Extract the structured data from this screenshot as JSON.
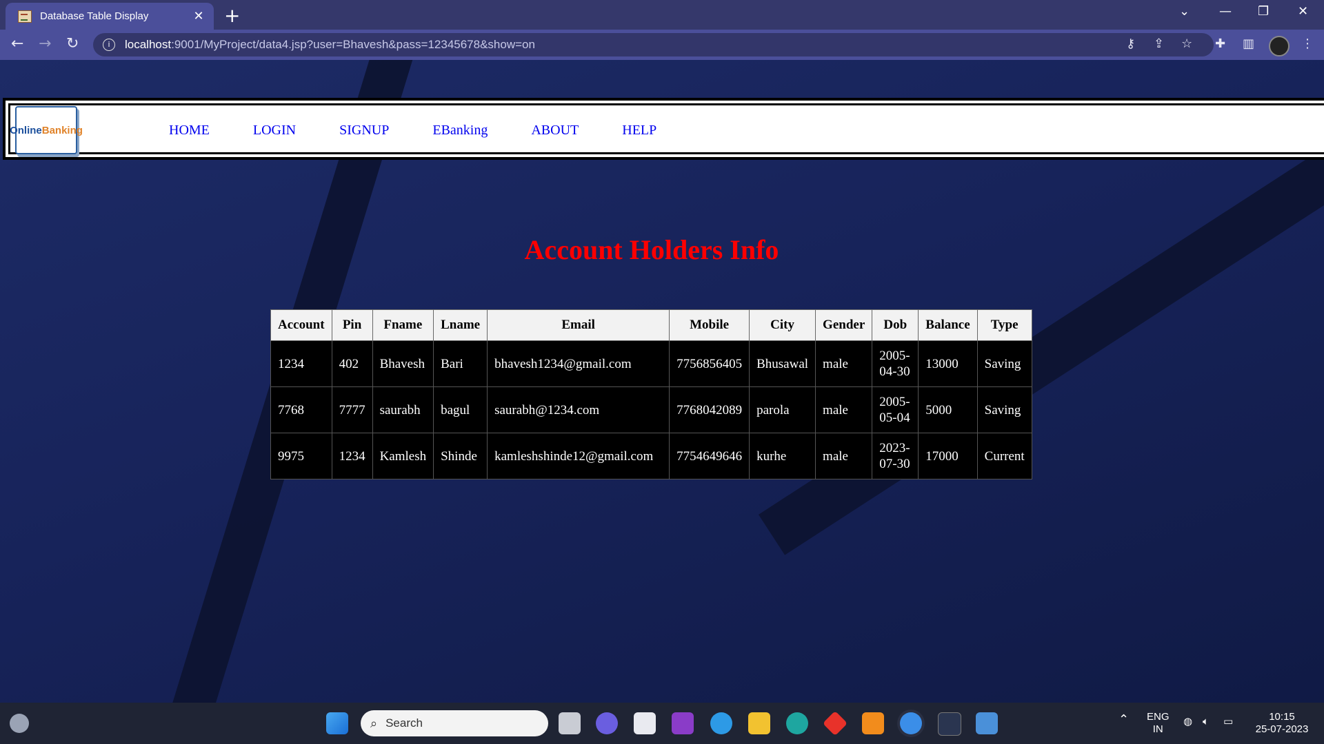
{
  "browser": {
    "tab_title": "Database Table Display",
    "tab_close": "✕",
    "new_tab": "+",
    "url_host": "localhost",
    "url_path": ":9001/MyProject/data4.jsp?user=Bhavesh&pass=12345678&show=on"
  },
  "nav": {
    "logo_part1": "Online",
    "logo_part2": "Banking",
    "items": [
      {
        "label": "HOME"
      },
      {
        "label": "LOGIN"
      },
      {
        "label": "SIGNUP"
      },
      {
        "label": "EBanking"
      },
      {
        "label": "ABOUT"
      },
      {
        "label": "HELP"
      }
    ]
  },
  "page": {
    "heading": "Account Holders Info"
  },
  "table": {
    "columns": [
      "Account",
      "Pin",
      "Fname",
      "Lname",
      "Email",
      "Mobile",
      "City",
      "Gender",
      "Dob",
      "Balance",
      "Type"
    ],
    "rows": [
      [
        "1234",
        "402",
        "Bhavesh",
        "Bari",
        "bhavesh1234@gmail.com",
        "7756856405",
        "Bhusawal",
        "male",
        "2005-04-30",
        "13000",
        "Saving"
      ],
      [
        "7768",
        "7777",
        "saurabh",
        "bagul",
        "saurabh@1234.com",
        "7768042089",
        "parola",
        "male",
        "2005-05-04",
        "5000",
        "Saving"
      ],
      [
        "9975",
        "1234",
        "Kamlesh",
        "Shinde",
        "kamleshshinde12@gmail.com",
        "7754649646",
        "kurhe",
        "male",
        "2023-07-30",
        "17000",
        "Current"
      ]
    ]
  },
  "taskbar": {
    "search_placeholder": "Search",
    "lang_line1": "ENG",
    "lang_line2": "IN",
    "time": "10:15",
    "date": "25-07-2023"
  }
}
